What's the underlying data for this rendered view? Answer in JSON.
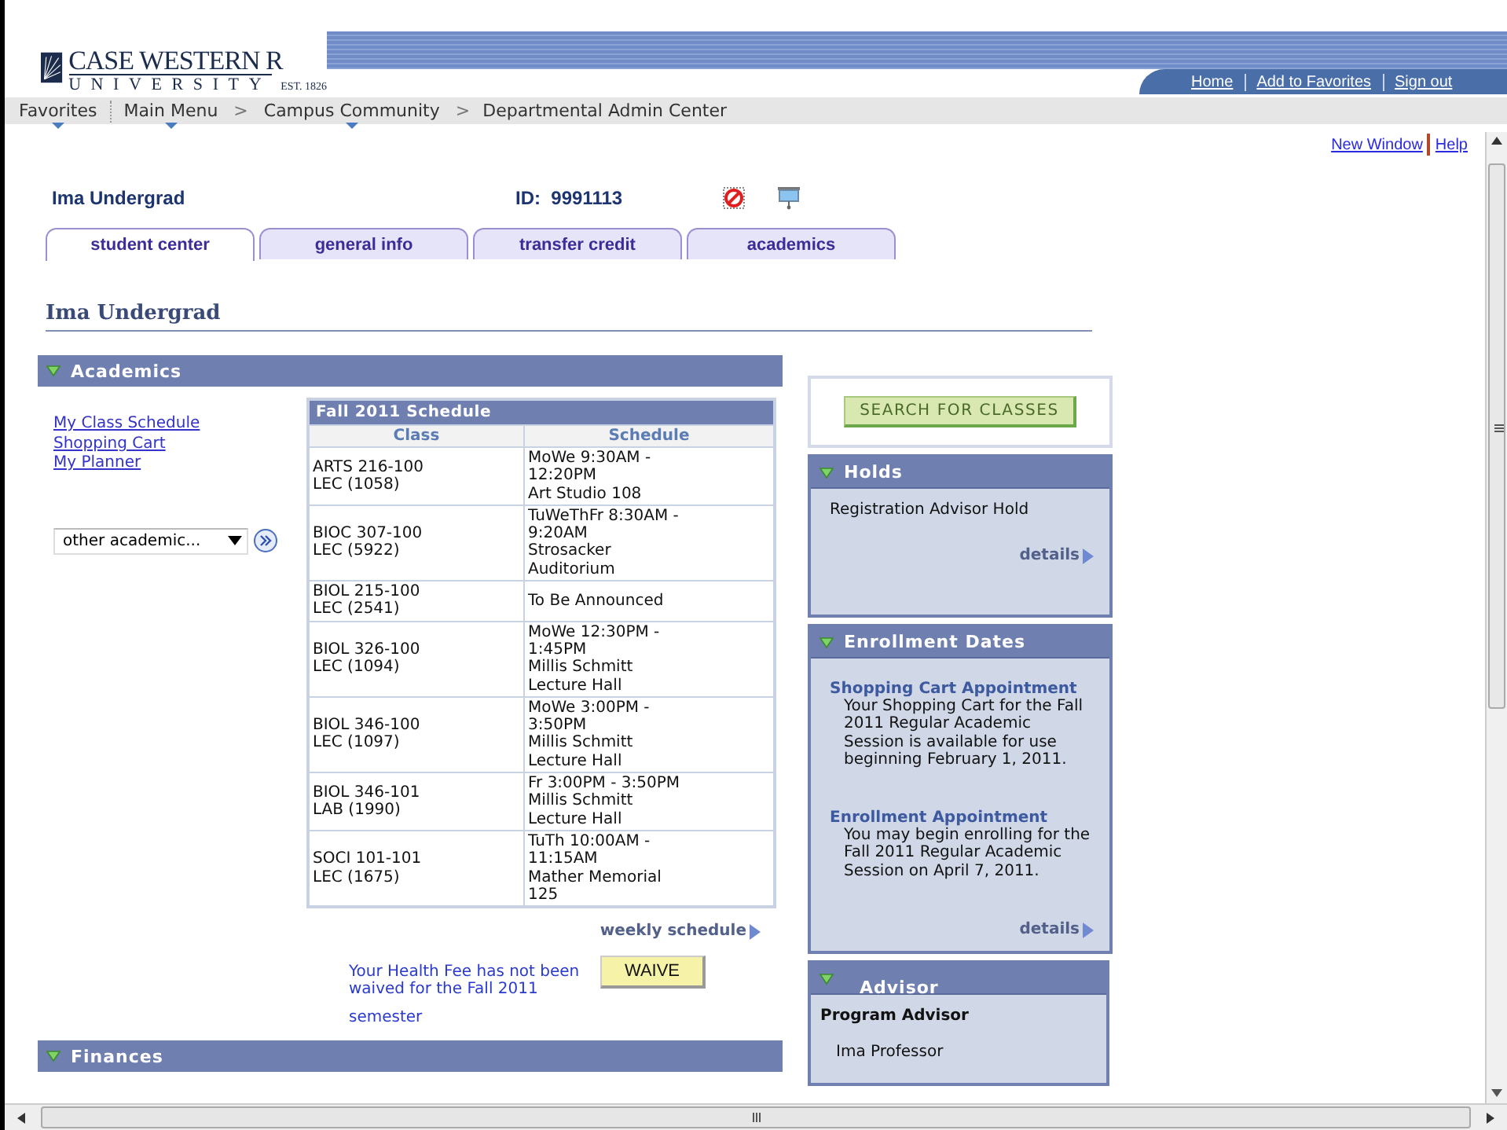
{
  "header": {
    "logo": {
      "name": "CASE WESTERN R",
      "sub": "UNIVERSITY",
      "est": "EST. 1826"
    },
    "links": [
      "Home",
      "Add to Favorites",
      "Sign out"
    ]
  },
  "nav": {
    "items": [
      {
        "kind": "menu",
        "label": "Favorites"
      },
      {
        "kind": "divider"
      },
      {
        "kind": "menu",
        "label": "Main Menu"
      },
      {
        "kind": "sep",
        "label": ">"
      },
      {
        "kind": "menu",
        "label": "Campus Community"
      },
      {
        "kind": "sep",
        "label": ">"
      },
      {
        "kind": "crumb",
        "label": "Departmental Admin Center"
      }
    ]
  },
  "page_links": [
    "New Window",
    "Help"
  ],
  "student": {
    "name": "Ima Undergrad",
    "id_label": "ID:",
    "id": "9991113"
  },
  "tabs": [
    {
      "label": "student center",
      "selected": true
    },
    {
      "label": "general info",
      "selected": false
    },
    {
      "label": "transfer credit",
      "selected": false
    },
    {
      "label": "academics",
      "selected": false
    }
  ],
  "page_title": "Ima Undergrad",
  "academics": {
    "title": "Academics",
    "expanded": true,
    "links": [
      "My Class Schedule",
      "Shopping Cart",
      "My Planner"
    ],
    "dropdown": {
      "value": "other academic..."
    },
    "schedule": {
      "title": "Fall 2011 Schedule",
      "columns": [
        "Class",
        "Schedule"
      ],
      "rows": [
        {
          "class": [
            "ARTS 216-100",
            "LEC (1058)"
          ],
          "schedule": [
            "MoWe 9:30AM -",
            "12:20PM",
            "Art Studio 108"
          ]
        },
        {
          "class": [
            "BIOC 307-100",
            "LEC (5922)"
          ],
          "schedule": [
            "TuWeThFr 8:30AM -",
            "9:20AM",
            "Strosacker",
            "Auditorium"
          ]
        },
        {
          "class": [
            "BIOL 215-100",
            "LEC (2541)"
          ],
          "schedule": [
            "To Be Announced"
          ]
        },
        {
          "class": [
            "BIOL 326-100",
            "LEC (1094)"
          ],
          "schedule": [
            "MoWe 12:30PM -",
            "1:45PM",
            "Millis Schmitt",
            "Lecture Hall"
          ]
        },
        {
          "class": [
            "BIOL 346-100",
            "LEC (1097)"
          ],
          "schedule": [
            "MoWe 3:00PM -",
            "3:50PM",
            "Millis Schmitt",
            "Lecture Hall"
          ]
        },
        {
          "class": [
            "BIOL 346-101",
            "LAB (1990)"
          ],
          "schedule": [
            "Fr 3:00PM - 3:50PM",
            "Millis Schmitt",
            "Lecture Hall"
          ]
        },
        {
          "class": [
            "SOCI 101-101",
            "LEC (1675)"
          ],
          "schedule": [
            "TuTh 10:00AM -",
            "11:15AM",
            "Mather Memorial",
            "125"
          ]
        }
      ]
    },
    "weekly_link": "weekly schedule",
    "health": {
      "message": "Your Health Fee has not been waived for the Fall 2011",
      "message_end": "semester",
      "button": "WAIVE"
    }
  },
  "finances": {
    "title": "Finances",
    "expanded": true
  },
  "search_button": "SEARCH FOR CLASSES",
  "holds": {
    "title": "Holds",
    "expanded": true,
    "items": [
      "Registration Advisor Hold"
    ],
    "link": "details"
  },
  "enrollment": {
    "title": "Enrollment Dates",
    "expanded": true,
    "appointments": [
      {
        "heading": "Shopping Cart Appointment",
        "text": "Your Shopping Cart for the Fall 2011 Regular Academic Session is available for use beginning February 1, 2011."
      },
      {
        "heading": "Enrollment Appointment",
        "text": "You may begin enrolling for the Fall 2011 Regular Academic Session on April 7, 2011."
      }
    ],
    "link": "details"
  },
  "advisor": {
    "title": "Advisor",
    "expanded": true,
    "role": "Program Advisor",
    "name": "Ima Professor"
  }
}
